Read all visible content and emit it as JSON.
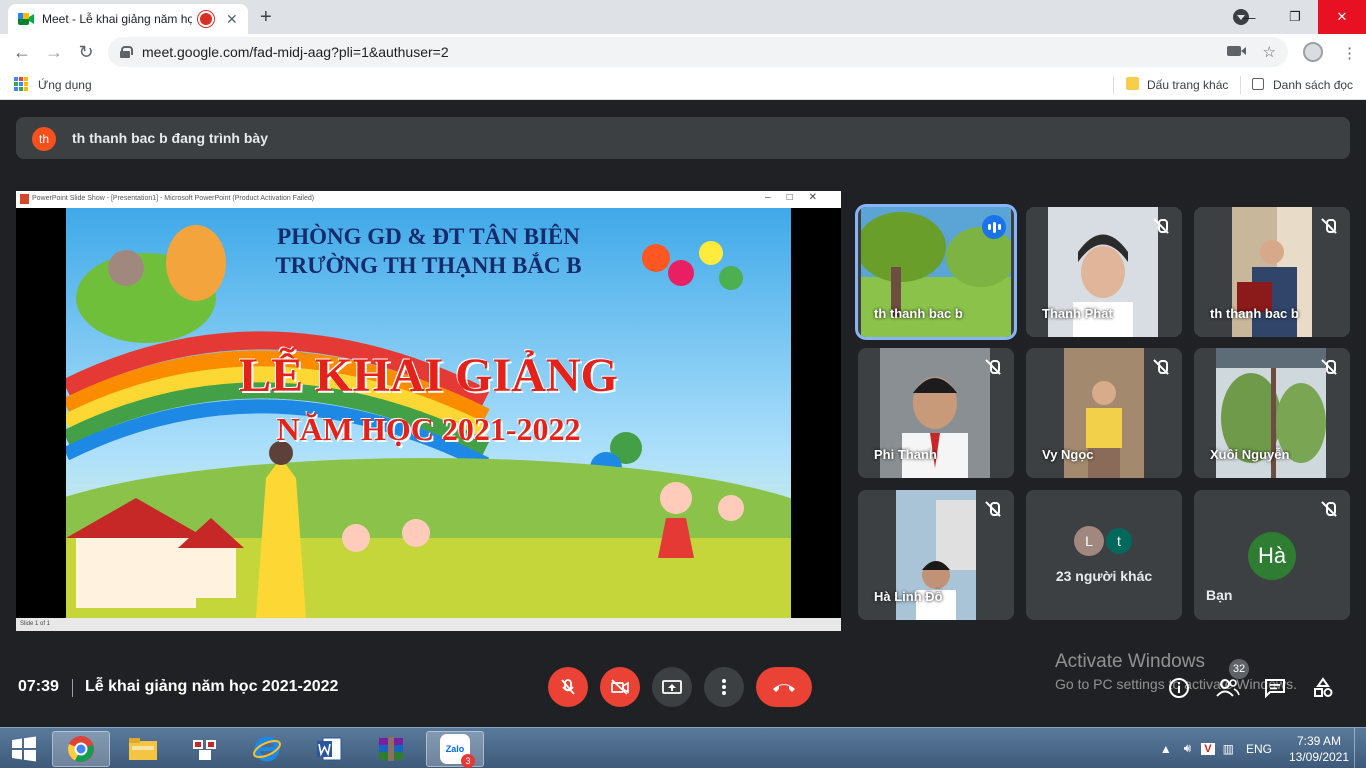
{
  "browser": {
    "tab_title": "Meet - Lễ khai giảng năm học",
    "url": "meet.google.com/fad-midj-aag?pli=1&authuser=2",
    "bookmarks": {
      "apps_label": "Ứng dụng",
      "other_label": "Dấu trang khác",
      "reading_list_label": "Danh sách đọc"
    }
  },
  "meet": {
    "presenting_banner": {
      "avatar": "th",
      "text": "th thanh bac b đang trình bày"
    },
    "presentation": {
      "window_title": "PowerPoint Slide Show - [Presentation1] - Microsoft PowerPoint (Product Activation Failed)",
      "status": "Slide 1 of 1",
      "slide": {
        "line1": "PHÒNG GD & ĐT TÂN BIÊN",
        "line2": "TRƯỜNG TH THẠNH BẮC B",
        "line3": "LỄ KHAI GIẢNG",
        "line4": "NĂM HỌC 2021-2022"
      }
    },
    "participants": [
      {
        "name": "th thanh bac b"
      },
      {
        "name": "Thanh Phat"
      },
      {
        "name": "th thanh bac b"
      },
      {
        "name": "Phi Thanh"
      },
      {
        "name": "Vy Ngọc"
      },
      {
        "name": "Xuôi Nguyễn"
      },
      {
        "name": "Hà Linh Đỗ"
      }
    ],
    "others": {
      "avatars": [
        "L",
        "t"
      ],
      "label": "23 người khác"
    },
    "self": {
      "avatar": "Hà",
      "label": "Bạn"
    },
    "bottom": {
      "time": "07:39",
      "meeting_name": "Lễ khai giảng năm học 2021-2022",
      "participant_count": "32"
    },
    "watermark": {
      "line1": "Activate Windows",
      "line2": "Go to PC settings to activate Windows."
    }
  },
  "taskbar": {
    "zalo_badge": "3",
    "lang": "ENG",
    "time": "7:39 AM",
    "date": "13/09/2021"
  },
  "colors": {
    "meet_bg": "#202124",
    "tile_bg": "#3c4043",
    "danger": "#ea4335",
    "accent": "#8ab4f8"
  }
}
